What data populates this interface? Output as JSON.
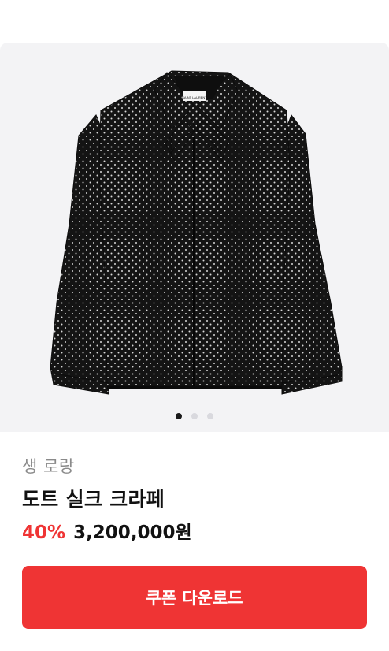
{
  "product": {
    "brand": "생 로랑",
    "title": "도트 실크 크라페",
    "discount": "40%",
    "price": "3,200,000원",
    "image_label_text": "SAINT LAURENT"
  },
  "gallery": {
    "slide_count": 3,
    "active_index": 0
  },
  "actions": {
    "coupon_label": "쿠폰 다운로드"
  },
  "colors": {
    "accent": "#ef3434",
    "gallery_bg": "#f3f3f5",
    "shirt": "#141414",
    "dot_active": "#1a1a1a",
    "dot_inactive": "#d9d9de"
  }
}
